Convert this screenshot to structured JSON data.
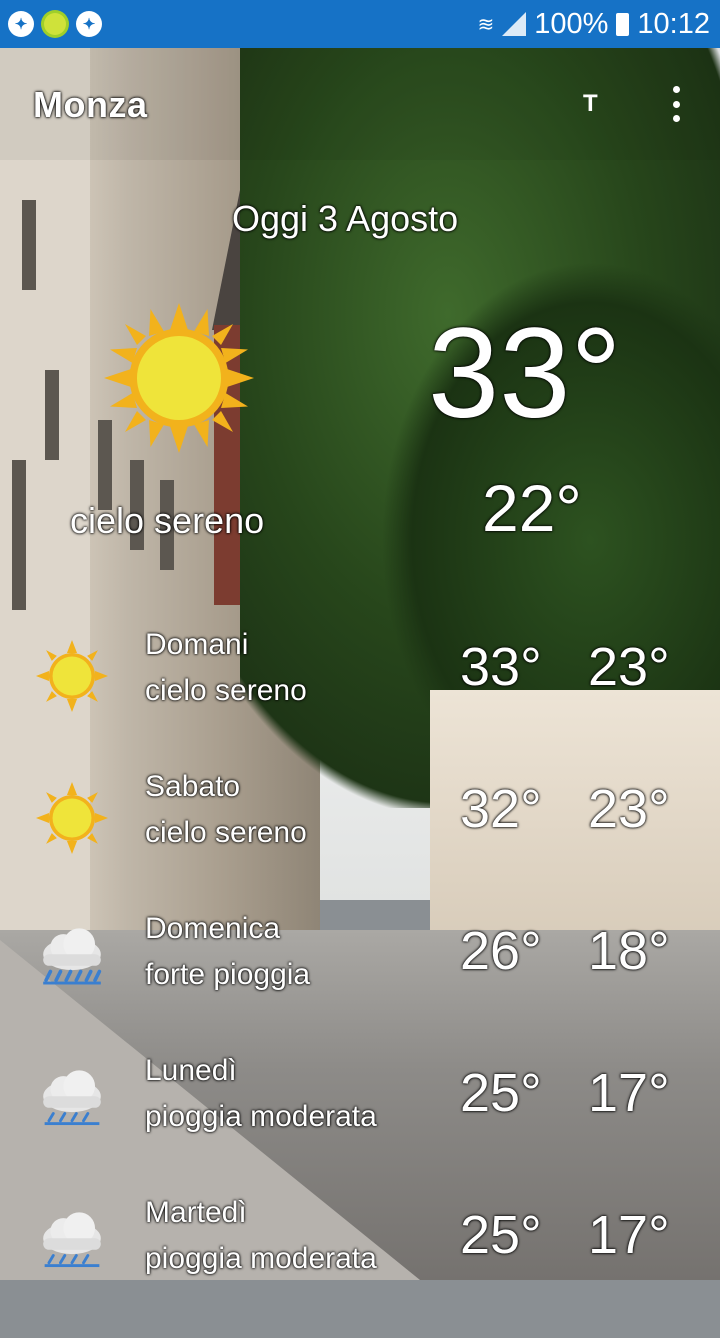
{
  "statusbar": {
    "battery": "100%",
    "time": "10:12",
    "left_icons": [
      "messenger-icon",
      "sun-app-icon",
      "messenger-icon"
    ],
    "color": "#1672c6"
  },
  "toolbar": {
    "title": "Monza",
    "t_button": "T"
  },
  "today": {
    "date": "Oggi 3 Agosto",
    "temp_max": "33°",
    "temp_min": "22°",
    "condition": "cielo sereno",
    "icon": "sun-icon"
  },
  "forecast": [
    {
      "day": "Domani",
      "desc": "cielo sereno",
      "max": "33°",
      "min": "23°",
      "icon": "sun-icon"
    },
    {
      "day": "Sabato",
      "desc": "cielo sereno",
      "max": "32°",
      "min": "23°",
      "icon": "sun-icon"
    },
    {
      "day": "Domenica",
      "desc": "forte pioggia",
      "max": "26°",
      "min": "18°",
      "icon": "rain-cloud-icon"
    },
    {
      "day": "Lunedì",
      "desc": "pioggia moderata",
      "max": "25°",
      "min": "17°",
      "icon": "rain-cloud-icon"
    },
    {
      "day": "Martedì",
      "desc": "pioggia moderata",
      "max": "25°",
      "min": "17°",
      "icon": "rain-cloud-icon"
    }
  ]
}
